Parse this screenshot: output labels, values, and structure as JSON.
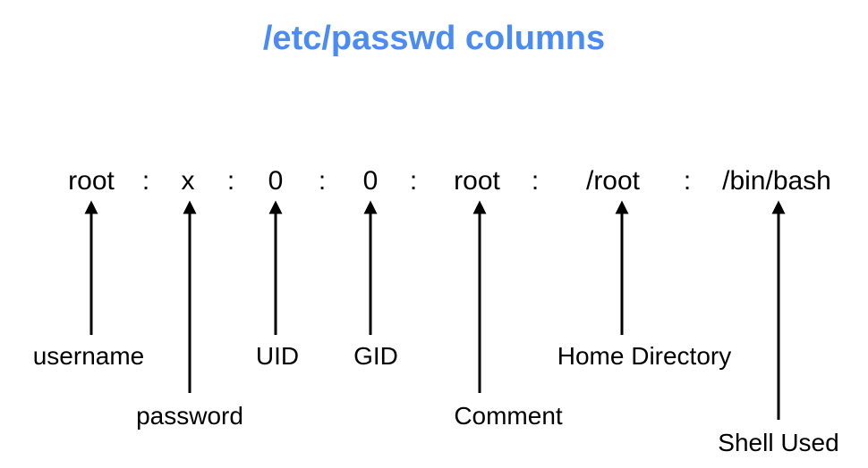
{
  "title": "/etc/passwd columns",
  "fields": {
    "f0": "root",
    "f1": "x",
    "f2": "0",
    "f3": "0",
    "f4": "root",
    "f5": "/root",
    "f6": "/bin/bash"
  },
  "separator": ":",
  "labels": {
    "l0": "username",
    "l1": "password",
    "l2": "UID",
    "l3": "GID",
    "l4": "Comment",
    "l5": "Home Directory",
    "l6": "Shell Used"
  }
}
